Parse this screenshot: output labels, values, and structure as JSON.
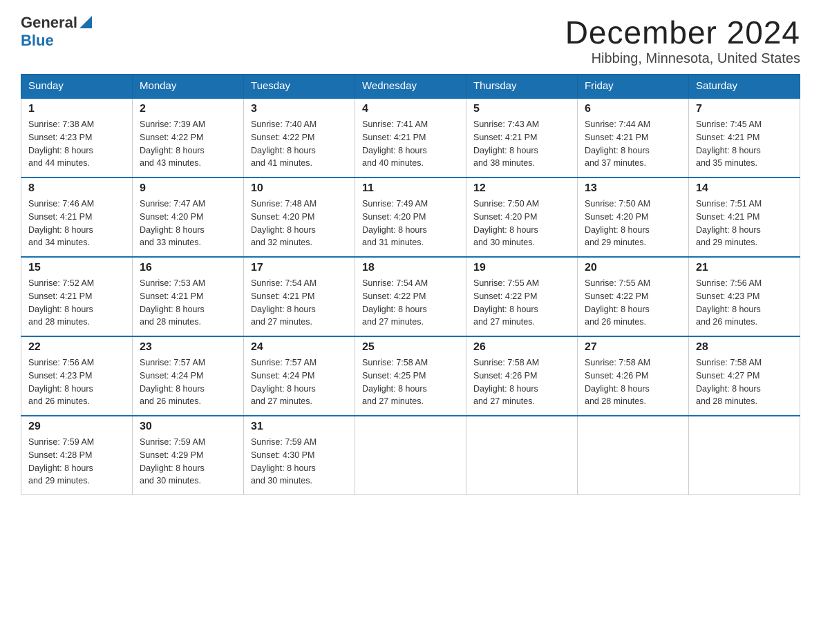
{
  "logo": {
    "text_general": "General",
    "text_blue": "Blue"
  },
  "title": "December 2024",
  "subtitle": "Hibbing, Minnesota, United States",
  "days_of_week": [
    "Sunday",
    "Monday",
    "Tuesday",
    "Wednesday",
    "Thursday",
    "Friday",
    "Saturday"
  ],
  "weeks": [
    [
      {
        "day": "1",
        "sunrise": "7:38 AM",
        "sunset": "4:23 PM",
        "daylight": "8 hours and 44 minutes."
      },
      {
        "day": "2",
        "sunrise": "7:39 AM",
        "sunset": "4:22 PM",
        "daylight": "8 hours and 43 minutes."
      },
      {
        "day": "3",
        "sunrise": "7:40 AM",
        "sunset": "4:22 PM",
        "daylight": "8 hours and 41 minutes."
      },
      {
        "day": "4",
        "sunrise": "7:41 AM",
        "sunset": "4:21 PM",
        "daylight": "8 hours and 40 minutes."
      },
      {
        "day": "5",
        "sunrise": "7:43 AM",
        "sunset": "4:21 PM",
        "daylight": "8 hours and 38 minutes."
      },
      {
        "day": "6",
        "sunrise": "7:44 AM",
        "sunset": "4:21 PM",
        "daylight": "8 hours and 37 minutes."
      },
      {
        "day": "7",
        "sunrise": "7:45 AM",
        "sunset": "4:21 PM",
        "daylight": "8 hours and 35 minutes."
      }
    ],
    [
      {
        "day": "8",
        "sunrise": "7:46 AM",
        "sunset": "4:21 PM",
        "daylight": "8 hours and 34 minutes."
      },
      {
        "day": "9",
        "sunrise": "7:47 AM",
        "sunset": "4:20 PM",
        "daylight": "8 hours and 33 minutes."
      },
      {
        "day": "10",
        "sunrise": "7:48 AM",
        "sunset": "4:20 PM",
        "daylight": "8 hours and 32 minutes."
      },
      {
        "day": "11",
        "sunrise": "7:49 AM",
        "sunset": "4:20 PM",
        "daylight": "8 hours and 31 minutes."
      },
      {
        "day": "12",
        "sunrise": "7:50 AM",
        "sunset": "4:20 PM",
        "daylight": "8 hours and 30 minutes."
      },
      {
        "day": "13",
        "sunrise": "7:50 AM",
        "sunset": "4:20 PM",
        "daylight": "8 hours and 29 minutes."
      },
      {
        "day": "14",
        "sunrise": "7:51 AM",
        "sunset": "4:21 PM",
        "daylight": "8 hours and 29 minutes."
      }
    ],
    [
      {
        "day": "15",
        "sunrise": "7:52 AM",
        "sunset": "4:21 PM",
        "daylight": "8 hours and 28 minutes."
      },
      {
        "day": "16",
        "sunrise": "7:53 AM",
        "sunset": "4:21 PM",
        "daylight": "8 hours and 28 minutes."
      },
      {
        "day": "17",
        "sunrise": "7:54 AM",
        "sunset": "4:21 PM",
        "daylight": "8 hours and 27 minutes."
      },
      {
        "day": "18",
        "sunrise": "7:54 AM",
        "sunset": "4:22 PM",
        "daylight": "8 hours and 27 minutes."
      },
      {
        "day": "19",
        "sunrise": "7:55 AM",
        "sunset": "4:22 PM",
        "daylight": "8 hours and 27 minutes."
      },
      {
        "day": "20",
        "sunrise": "7:55 AM",
        "sunset": "4:22 PM",
        "daylight": "8 hours and 26 minutes."
      },
      {
        "day": "21",
        "sunrise": "7:56 AM",
        "sunset": "4:23 PM",
        "daylight": "8 hours and 26 minutes."
      }
    ],
    [
      {
        "day": "22",
        "sunrise": "7:56 AM",
        "sunset": "4:23 PM",
        "daylight": "8 hours and 26 minutes."
      },
      {
        "day": "23",
        "sunrise": "7:57 AM",
        "sunset": "4:24 PM",
        "daylight": "8 hours and 26 minutes."
      },
      {
        "day": "24",
        "sunrise": "7:57 AM",
        "sunset": "4:24 PM",
        "daylight": "8 hours and 27 minutes."
      },
      {
        "day": "25",
        "sunrise": "7:58 AM",
        "sunset": "4:25 PM",
        "daylight": "8 hours and 27 minutes."
      },
      {
        "day": "26",
        "sunrise": "7:58 AM",
        "sunset": "4:26 PM",
        "daylight": "8 hours and 27 minutes."
      },
      {
        "day": "27",
        "sunrise": "7:58 AM",
        "sunset": "4:26 PM",
        "daylight": "8 hours and 28 minutes."
      },
      {
        "day": "28",
        "sunrise": "7:58 AM",
        "sunset": "4:27 PM",
        "daylight": "8 hours and 28 minutes."
      }
    ],
    [
      {
        "day": "29",
        "sunrise": "7:59 AM",
        "sunset": "4:28 PM",
        "daylight": "8 hours and 29 minutes."
      },
      {
        "day": "30",
        "sunrise": "7:59 AM",
        "sunset": "4:29 PM",
        "daylight": "8 hours and 30 minutes."
      },
      {
        "day": "31",
        "sunrise": "7:59 AM",
        "sunset": "4:30 PM",
        "daylight": "8 hours and 30 minutes."
      },
      null,
      null,
      null,
      null
    ]
  ],
  "labels": {
    "sunrise": "Sunrise:",
    "sunset": "Sunset:",
    "daylight": "Daylight:"
  }
}
